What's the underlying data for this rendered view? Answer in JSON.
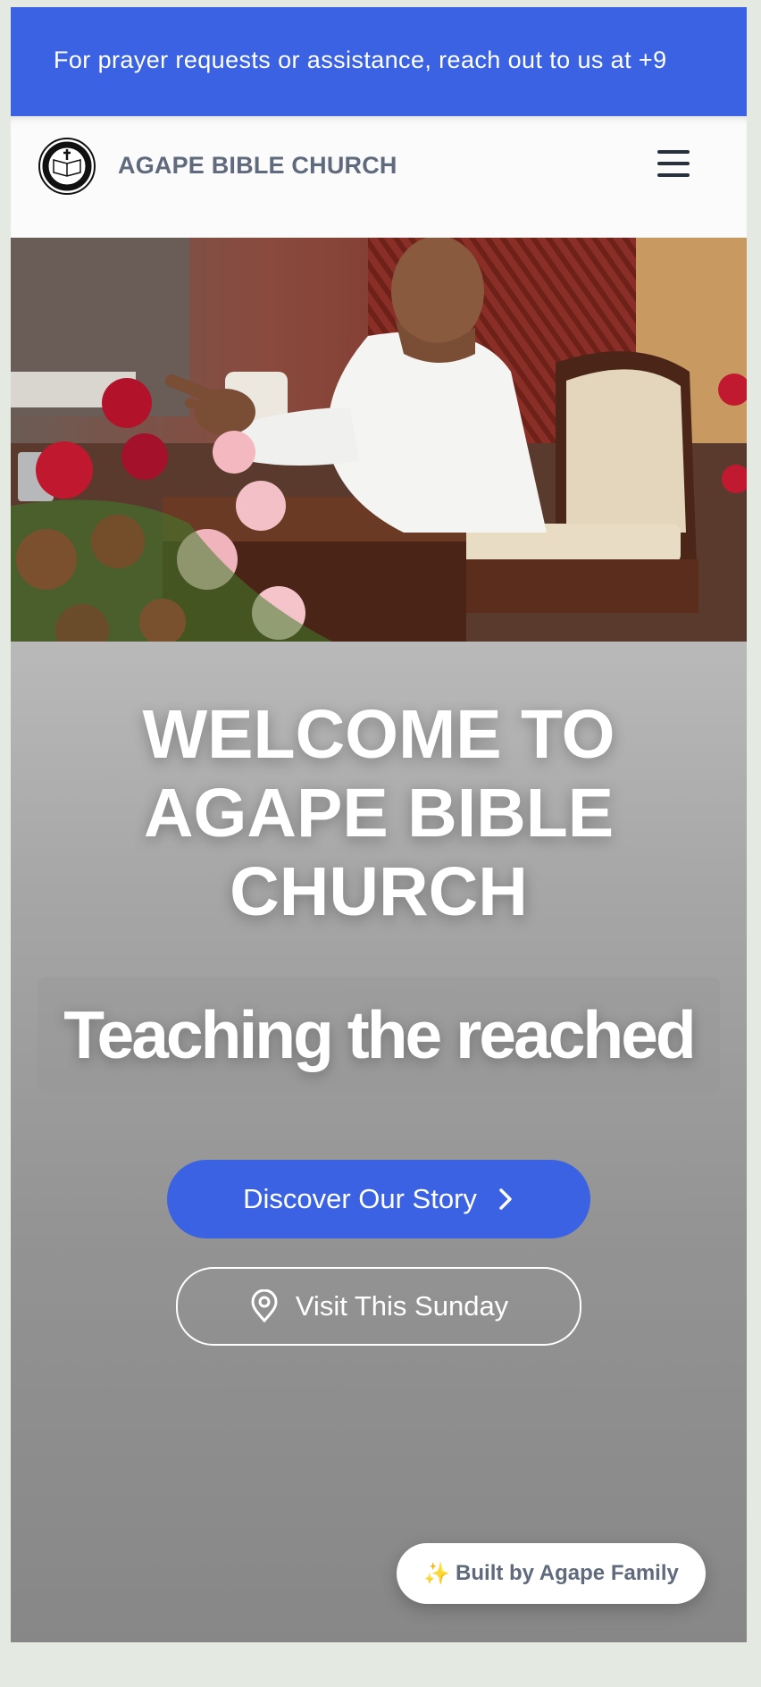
{
  "announcement": {
    "text": "For prayer requests or assistance, reach out to us at +9"
  },
  "navbar": {
    "brand_name": "AGAPE BIBLE CHURCH",
    "logo_icon": "church-seal-logo",
    "menu_icon": "hamburger-menu-icon"
  },
  "hero": {
    "heading": "WELCOME TO AGAPE BIBLE CHURCH",
    "tagline": "Teaching the reached",
    "primary_button": "Discover Our Story",
    "primary_button_icon": "chevron-right-icon",
    "secondary_button": "Visit This Sunday",
    "secondary_button_icon": "map-pin-icon"
  },
  "badge": {
    "icon": "sparkles",
    "sparkle": "✨",
    "label": "Built by Agape Family"
  },
  "colors": {
    "accent": "#3a62e2",
    "brand_text": "#5f6b7d",
    "page_background": "#e4eae2"
  }
}
